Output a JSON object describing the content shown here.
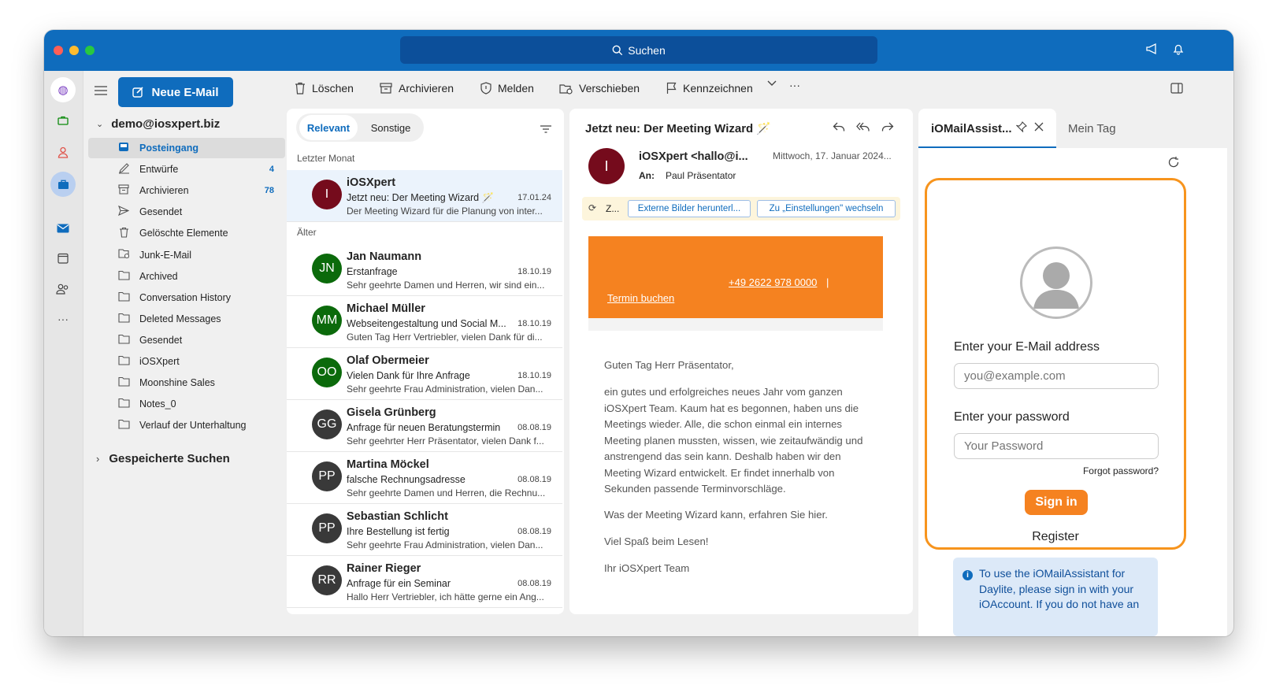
{
  "titlebar": {
    "search_label": "Suchen"
  },
  "sidebar": {
    "new_mail": "Neue E-Mail",
    "account": "demo@iosxpert.biz",
    "folders": [
      {
        "label": "Posteingang",
        "count": ""
      },
      {
        "label": "Entwürfe",
        "count": "4"
      },
      {
        "label": "Archivieren",
        "count": "78"
      },
      {
        "label": "Gesendet",
        "count": ""
      },
      {
        "label": "Gelöschte Elemente",
        "count": ""
      },
      {
        "label": "Junk-E-Mail",
        "count": ""
      },
      {
        "label": "Archived",
        "count": ""
      },
      {
        "label": "Conversation History",
        "count": ""
      },
      {
        "label": "Deleted Messages",
        "count": ""
      },
      {
        "label": "Gesendet",
        "count": ""
      },
      {
        "label": "iOSXpert",
        "count": ""
      },
      {
        "label": "Moonshine Sales",
        "count": ""
      },
      {
        "label": "Notes_0",
        "count": ""
      },
      {
        "label": "Verlauf der Unterhaltung",
        "count": ""
      }
    ],
    "saved_searches": "Gespeicherte Suchen"
  },
  "toolbar": {
    "delete": "Löschen",
    "archive": "Archivieren",
    "report": "Melden",
    "move": "Verschieben",
    "flag": "Kennzeichnen",
    "more": "···"
  },
  "maillist": {
    "tab_relevant": "Relevant",
    "tab_other": "Sonstige",
    "group_last_month": "Letzter Monat",
    "group_older": "Älter",
    "mails": [
      {
        "initials": "I",
        "color": "#750b1c",
        "from": "iOSXpert",
        "subject": "Jetzt neu: Der Meeting Wizard 🪄",
        "date": "17.01.24",
        "preview": "Der Meeting Wizard für die Planung von inter..."
      },
      {
        "initials": "JN",
        "color": "#0b6a0b",
        "from": "Jan Naumann",
        "subject": "Erstanfrage",
        "date": "18.10.19",
        "preview": "Sehr geehrte Damen und Herren, wir sind ein..."
      },
      {
        "initials": "MM",
        "color": "#0b6a0b",
        "from": "Michael Müller",
        "subject": "Webseitengestaltung und Social M...",
        "date": "18.10.19",
        "preview": "Guten Tag Herr Vertriebler, vielen Dank für di..."
      },
      {
        "initials": "OO",
        "color": "#0b6a0b",
        "from": "Olaf Obermeier",
        "subject": "Vielen Dank für Ihre Anfrage",
        "date": "18.10.19",
        "preview": "Sehr geehrte Frau Administration, vielen Dan..."
      },
      {
        "initials": "GG",
        "color": "#393939",
        "from": "Gisela Grünberg",
        "subject": "Anfrage für neuen Beratungstermin",
        "date": "08.08.19",
        "preview": "Sehr geehrter Herr Präsentator, vielen Dank f..."
      },
      {
        "initials": "PP",
        "color": "#393939",
        "from": "Martina Möckel",
        "subject": "falsche Rechnungsadresse",
        "date": "08.08.19",
        "preview": "Sehr geehrte Damen und Herren, die Rechnu..."
      },
      {
        "initials": "PP",
        "color": "#393939",
        "from": "Sebastian Schlicht",
        "subject": "Ihre Bestellung ist fertig",
        "date": "08.08.19",
        "preview": "Sehr geehrte Frau Administration, vielen Dan..."
      },
      {
        "initials": "RR",
        "color": "#393939",
        "from": "Rainer Rieger",
        "subject": "Anfrage für ein Seminar",
        "date": "08.08.19",
        "preview": "Hallo Herr Vertriebler, ich hätte gerne ein Ang..."
      }
    ]
  },
  "reading": {
    "subject": "Jetzt neu: Der Meeting Wizard 🪄",
    "sender_initial": "I",
    "sender": "iOSXpert <hallo@i...",
    "date": "Mittwoch, 17. Januar 2024...",
    "to_label": "An:",
    "to": "Paul Präsentator",
    "info_short": "Z...",
    "btn_images": "Externe Bilder herunterl...",
    "btn_settings": "Zu „Einstellungen\" wechseln",
    "banner_phone": "+49 2622 978 0000",
    "banner_sep": "|",
    "banner_link": "Termin buchen",
    "greeting": "Guten Tag Herr Präsentator,",
    "para1": "ein gutes und erfolgreiches neues Jahr vom ganzen iOSXpert Team. Kaum hat es begonnen, haben uns die Meetings wieder. Alle, die schon einmal ein internes Meeting planen mussten, wissen, wie zeitaufwändig und anstrengend das sein kann. Deshalb haben wir den Meeting Wizard entwickelt. Er findet innerhalb von Sekunden passende Terminvorschläge.",
    "para2": "Was der Meeting Wizard kann, erfahren Sie hier.",
    "para3": "Viel Spaß beim Lesen!",
    "signature": "Ihr iOSXpert Team"
  },
  "addin": {
    "tab_active": "iOMailAssist...",
    "tab_other": "Mein Tag",
    "email_label": "Enter your E-Mail address",
    "email_placeholder": "you@example.com",
    "password_label": "Enter your password",
    "password_placeholder": "Your Password",
    "forgot": "Forgot password?",
    "sign_in": "Sign in",
    "register": "Register",
    "info_text": "To use the iOMailAssistant for Daylite, please sign in with your iOAccount. If you do not have an"
  },
  "colors": {
    "brand": "#0f6cbd",
    "accent_orange": "#f58220",
    "addin_border": "#f7941d"
  }
}
